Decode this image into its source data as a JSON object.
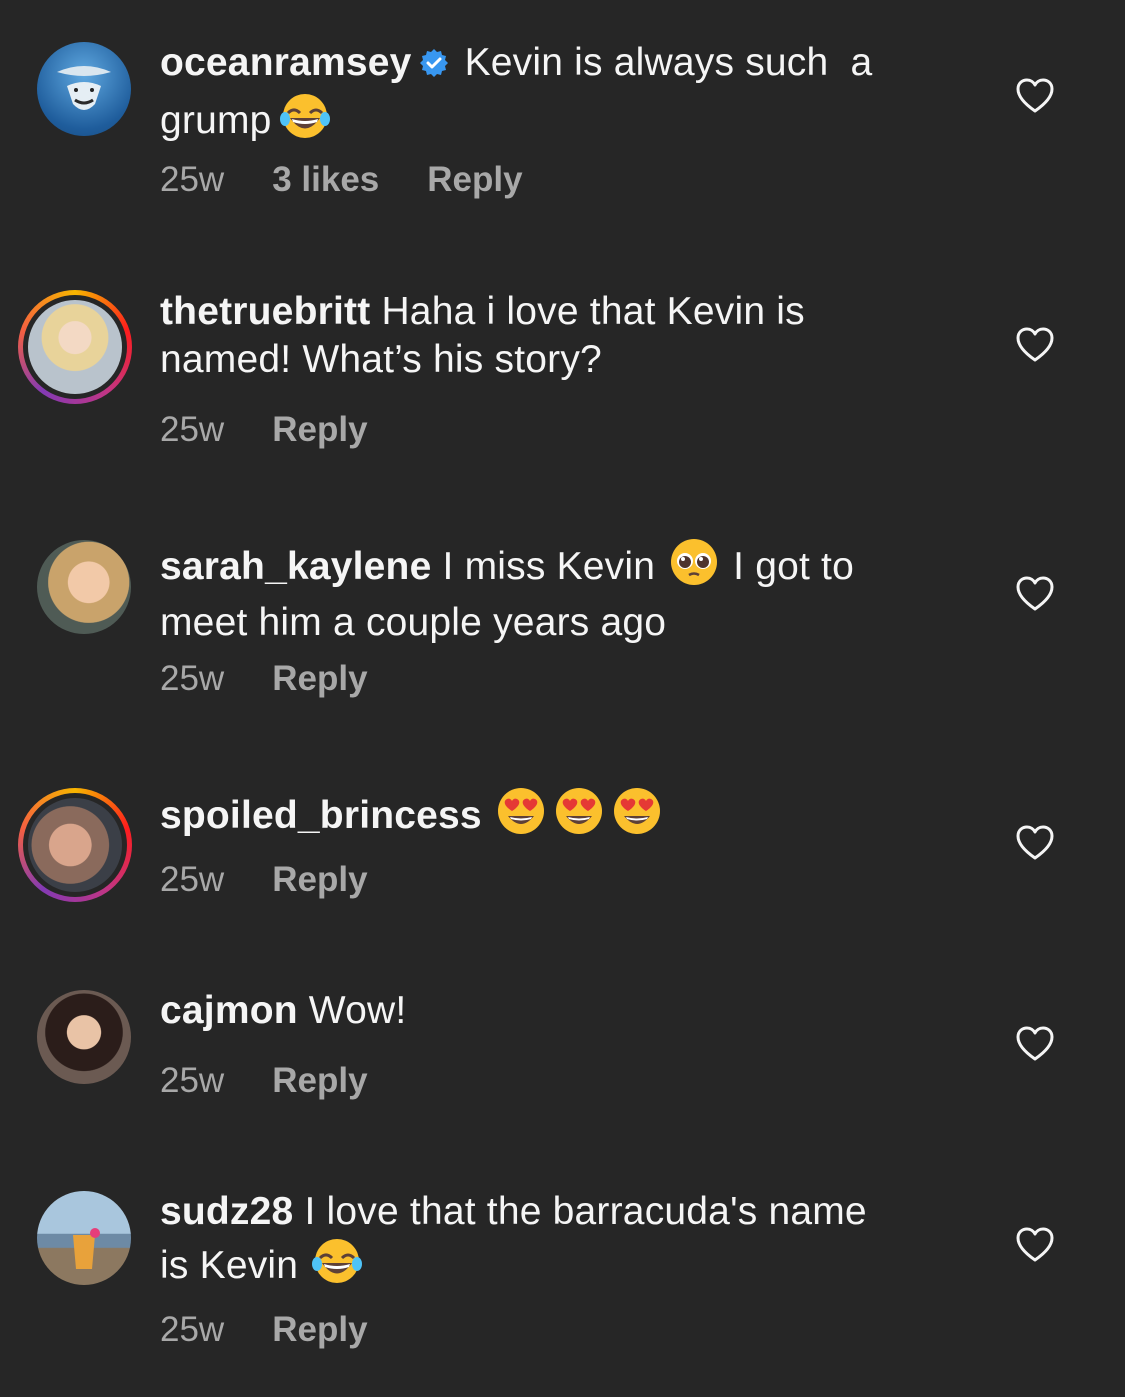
{
  "comments": [
    {
      "user": "oceanramsey",
      "text_line1": "Kevin is always such  a",
      "text_line2": "grump",
      "time": "25w",
      "likes": "3 likes",
      "reply": "Reply"
    },
    {
      "user": "thetruebritt",
      "text_line1": "Haha i love that Kevin is",
      "text_line2": "named! What’s his story?",
      "time": "25w",
      "reply": "Reply"
    },
    {
      "user": "sarah_kaylene",
      "text_line1": "I miss Kevin",
      "text_line1b": "I got to",
      "text_line2": "meet him a couple years ago",
      "time": "25w",
      "reply": "Reply"
    },
    {
      "user": "spoiled_brincess",
      "time": "25w",
      "reply": "Reply"
    },
    {
      "user": "cajmon",
      "text_line1": "Wow!",
      "time": "25w",
      "reply": "Reply"
    },
    {
      "user": "sudz28",
      "text_line1": "I love that the barracuda's name",
      "text_line2": "is Kevin",
      "time": "25w",
      "reply": "Reply"
    }
  ],
  "icons": {
    "like": "heart-outline-icon",
    "verified": "verified-badge-icon",
    "emoji_laugh": "tears-of-joy-emoji",
    "emoji_pleading": "pleading-face-emoji",
    "emoji_heart_eyes": "heart-eyes-emoji"
  },
  "colors": {
    "background": "#262626",
    "text": "#f5f5f5",
    "meta": "#a8a8a8",
    "verified": "#3897f0"
  }
}
